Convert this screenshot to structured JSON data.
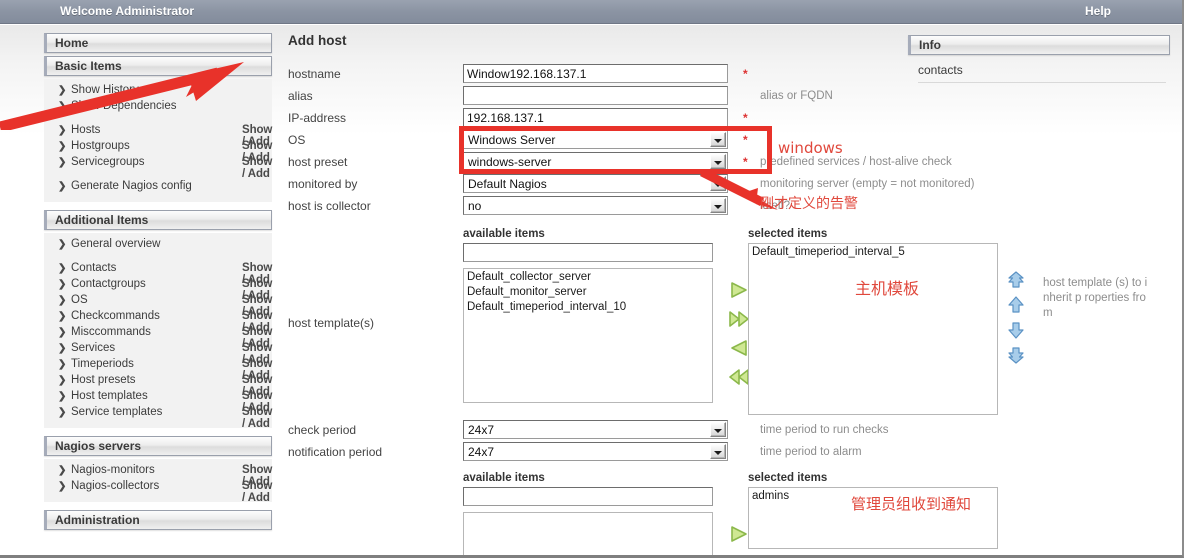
{
  "topbar": {
    "welcome": "Welcome Administrator",
    "help": "Help"
  },
  "sidebar": {
    "home_label": "Home",
    "sections": [
      {
        "title": "Basic Items",
        "items": [
          {
            "label": "Show History",
            "action": ""
          },
          {
            "label": "Show Dependencies",
            "action": ""
          },
          {
            "label": "",
            "action": "",
            "spacer": true
          },
          {
            "label": "Hosts",
            "action": "Show / Add"
          },
          {
            "label": "Hostgroups",
            "action": "Show / Add"
          },
          {
            "label": "Servicegroups",
            "action": "Show / Add"
          },
          {
            "label": "",
            "action": "",
            "spacer": true
          },
          {
            "label": "Generate Nagios config",
            "action": ""
          }
        ]
      },
      {
        "title": "Additional Items",
        "items": [
          {
            "label": "General overview",
            "action": ""
          },
          {
            "label": "",
            "action": "",
            "spacer": true
          },
          {
            "label": "Contacts",
            "action": "Show / Add"
          },
          {
            "label": "Contactgroups",
            "action": "Show / Add"
          },
          {
            "label": "OS",
            "action": "Show / Add"
          },
          {
            "label": "Checkcommands",
            "action": "Show / Add"
          },
          {
            "label": "Misccommands",
            "action": "Show / Add"
          },
          {
            "label": "Services",
            "action": "Show / Add"
          },
          {
            "label": "Timeperiods",
            "action": "Show / Add"
          },
          {
            "label": "Host presets",
            "action": "Show / Add"
          },
          {
            "label": "Host templates",
            "action": "Show / Add"
          },
          {
            "label": "Service templates",
            "action": "Show / Add"
          }
        ]
      },
      {
        "title": "Nagios servers",
        "items": [
          {
            "label": "Nagios-monitors",
            "action": "Show / Add"
          },
          {
            "label": "Nagios-collectors",
            "action": "Show / Add"
          }
        ]
      },
      {
        "title": "Administration",
        "items": []
      }
    ]
  },
  "main": {
    "page_title": "Add host",
    "fields": [
      {
        "label": "hostname",
        "type": "text",
        "value": "Window192.168.137.1",
        "placeholder": "",
        "required": "*",
        "hint": ""
      },
      {
        "label": "alias",
        "type": "text",
        "value": "",
        "placeholder": "",
        "required": "",
        "hint": "alias or FQDN"
      },
      {
        "label": "IP-address",
        "type": "text",
        "value": "192.168.137.1",
        "placeholder": "",
        "required": "*",
        "hint": ""
      },
      {
        "label": "OS",
        "type": "select",
        "value": "Windows Server",
        "required": "*",
        "hint": ""
      },
      {
        "label": "host preset",
        "type": "select",
        "value": "windows-server",
        "required": "*",
        "hint": "predefined services / host-alive check"
      },
      {
        "label": "monitored by",
        "type": "select",
        "value": "Default Nagios",
        "required": "",
        "hint": "monitoring server (empty = not monitored)"
      },
      {
        "label": "host is collector",
        "type": "select",
        "value": "no",
        "required": "",
        "hint": "itself?"
      }
    ],
    "host_template": {
      "label": "host template(s)",
      "available_label": "available items",
      "selected_label": "selected items",
      "filter_value": "",
      "available": [
        "Default_collector_server",
        "Default_monitor_server",
        "Default_timeperiod_interval_10"
      ],
      "selected": [
        "Default_timeperiod_interval_5"
      ],
      "hint": "host template (s) to inherit p roperties fro m"
    },
    "periods": [
      {
        "label": "check period",
        "value": "24x7",
        "hint": "time period to run checks"
      },
      {
        "label": "notification period",
        "value": "24x7",
        "hint": "time period to alarm"
      }
    ],
    "contactgroups": {
      "available_label": "available items",
      "selected_label": "selected items",
      "filter_value": "",
      "available": [],
      "selected": [
        "admins"
      ]
    }
  },
  "info": {
    "title": "Info",
    "rows": [
      "contacts"
    ]
  },
  "annotations": {
    "windows": "windows",
    "alarm_note": "刚才定义的告警",
    "host_template_note": "主机模板",
    "contactgroup_note": "管理员组收到通知"
  },
  "colors": {
    "accent_red": "#e8322a",
    "topbar": "#8b94a3",
    "required": "#dd3333",
    "hint": "#8d8d8d"
  }
}
